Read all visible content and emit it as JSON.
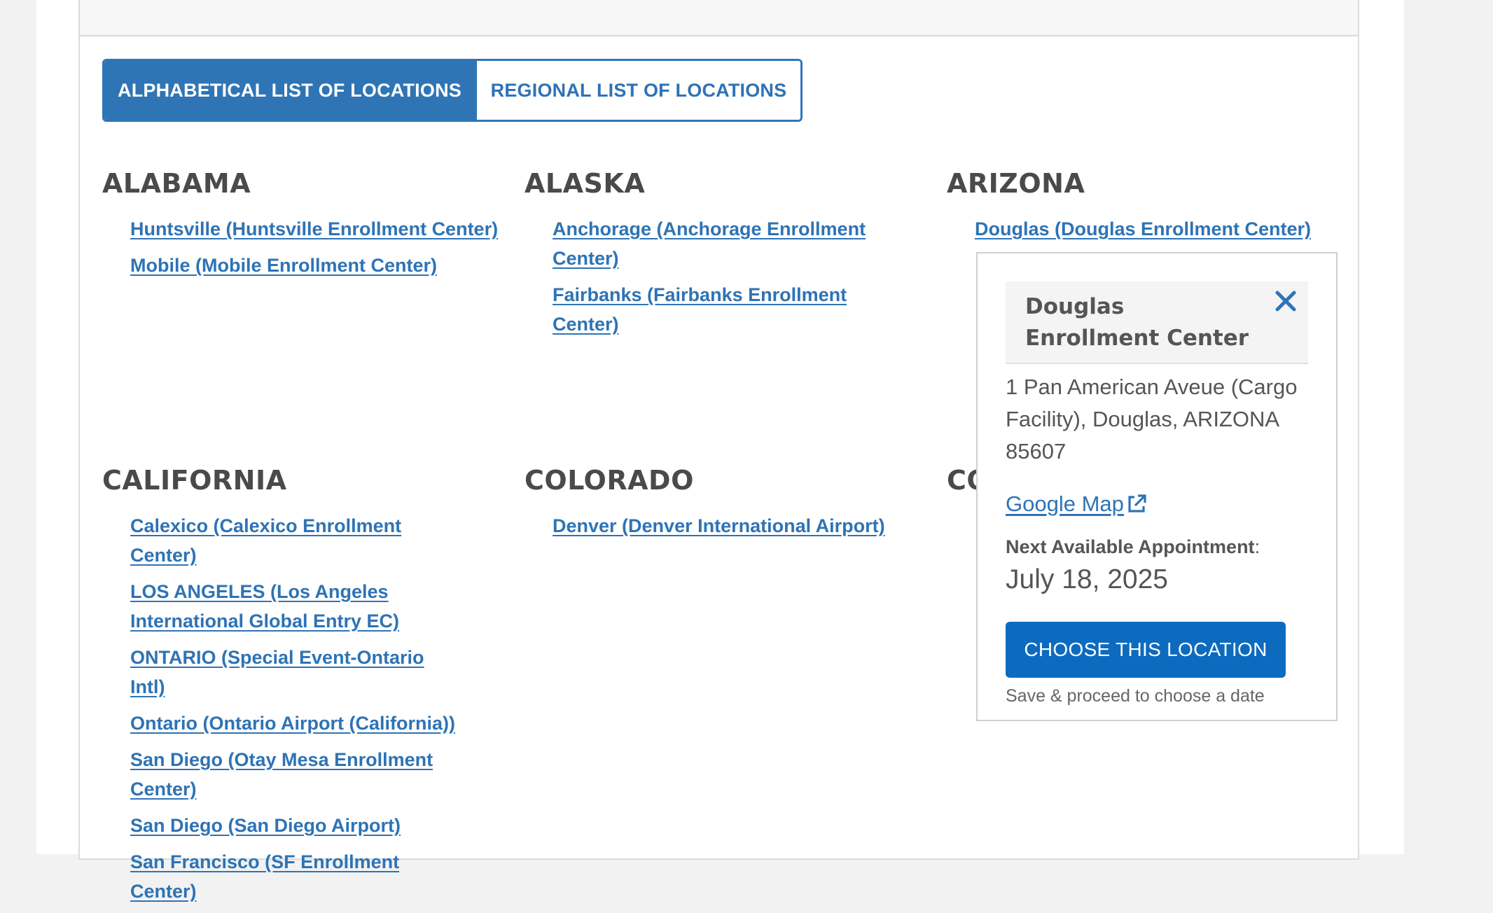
{
  "tabs": {
    "alphabetical": "ALPHABETICAL LIST OF LOCATIONS",
    "regional": "REGIONAL LIST OF LOCATIONS"
  },
  "states": [
    {
      "name": "ALABAMA",
      "locations": [
        "Huntsville (Huntsville Enrollment Center)",
        "Mobile (Mobile Enrollment Center)"
      ]
    },
    {
      "name": "ALASKA",
      "locations": [
        "Anchorage (Anchorage Enrollment Center)",
        "Fairbanks (Fairbanks Enrollment Center)"
      ]
    },
    {
      "name": "ARIZONA",
      "locations": [
        "Douglas (Douglas Enrollment Center)"
      ]
    },
    {
      "name": "CALIFORNIA",
      "locations": [
        "Calexico (Calexico Enrollment Center)",
        "LOS ANGELES (Los Angeles International Global Entry EC)",
        "ONTARIO (Special Event-Ontario Intl)",
        "Ontario (Ontario Airport (California))",
        "San Diego (Otay Mesa Enrollment Center)",
        "San Diego (San Diego Airport)",
        "San Francisco (SF Enrollment Center)"
      ]
    },
    {
      "name": "COLORADO",
      "locations": [
        "Denver (Denver International Airport)"
      ]
    },
    {
      "name": "CO",
      "locations": []
    }
  ],
  "popup": {
    "title": "Douglas Enrollment Center",
    "address": "1 Pan American Aveue (Cargo Facility), Douglas, ARIZONA 85607",
    "map_link": "Google Map",
    "appt_label": "Next Available Appointment",
    "appt_colon": ":",
    "appt_date": "July 18, 2025",
    "choose_button": "CHOOSE THIS LOCATION",
    "choose_note": "Save & proceed to choose a date"
  },
  "colors": {
    "link": "#2e73b5",
    "tab_active_bg": "#2f75b5",
    "button_bg": "#0d6bbf",
    "heading": "#4a4a4a"
  }
}
